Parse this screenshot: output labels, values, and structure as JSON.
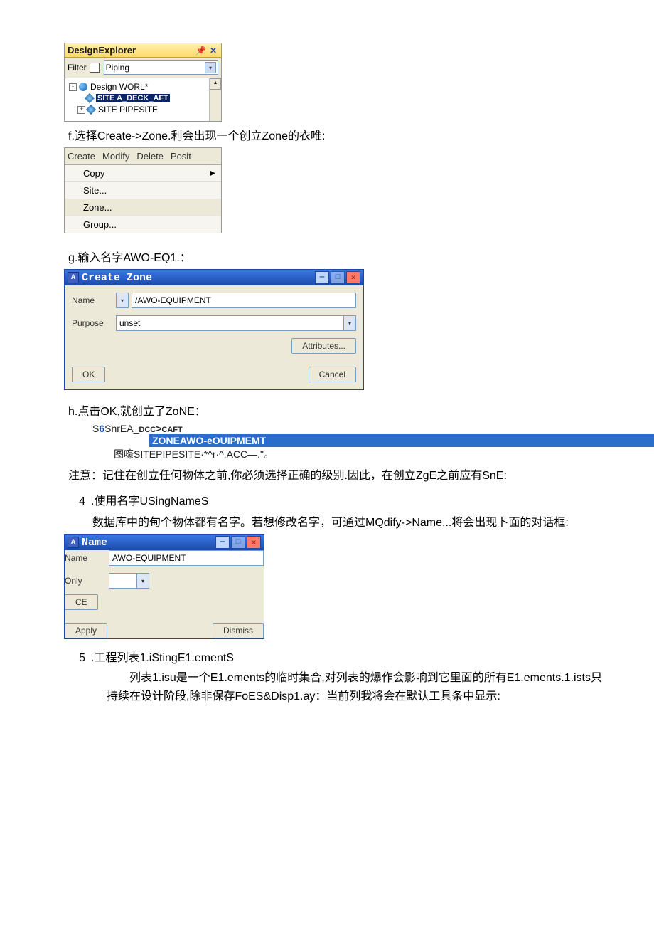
{
  "designExplorer": {
    "title": "DesignExplorer",
    "filterLabel": "Filter",
    "piping": "Piping",
    "rootNode": "Design WORL*",
    "selectedNode": "SITE A_DECK_AFT",
    "childNode": "SITE PIPESITE"
  },
  "stepF": "f.选择Create->Zone.利会出现一个创立Zone的衣唯:",
  "menu": {
    "create": "Create",
    "modify": "Modify",
    "delete": "Delete",
    "posit": "Posit",
    "copy": "Copy",
    "site": "Site...",
    "zone": "Zone...",
    "group": "Group..."
  },
  "stepG": "g.输入名字AWO-EQ1.：",
  "createZone": {
    "title": "Create Zone",
    "nameLabel": "Name",
    "nameValue": "/AWO-EQUIPMENT",
    "purposeLabel": "Purpose",
    "purposeValue": "unset",
    "attributesBtn": "Attributes...",
    "okBtn": "OK",
    "cancelBtn": "Cancel"
  },
  "stepH": "h.点击OK,就创立了ZoNE：",
  "hierarchy": {
    "line1": "S6SnrEA_DCC>CAFT",
    "zoneLine": "ZONEAWO-eOUIPMEMT",
    "line2": "图嚎SITEPIPESITE·*^r·^.ACC—.\"。"
  },
  "note": "注意：记住在创立任何物体之前,你必须选择正确的级别.因此，在创立ZgE之前应有SnE:",
  "item4": {
    "num": "4",
    "title": ".使用名字USingNameS",
    "body": "数据库中的甸个物体都有名字。若想修改名字，可通过MQdify->Name...将会出现卜面的对话框:"
  },
  "nameDialog": {
    "title": "Name",
    "nameLabel": "Name",
    "nameValue": "AWO-EQUIPMENT",
    "onlyLabel": "Only",
    "ceBtn": "CE",
    "applyBtn": "Apply",
    "dismissBtn": "Dismiss"
  },
  "item5": {
    "num": "5",
    "title": ".工程列表1.iStingE1.ementS",
    "body": "列表1.isu是一个E1.ements的临时集合,对列表的爆作会影响到它里面的所有E1.ements.1.ists只持续在设计阶段,除非保存FoES&Disp1.ay：当前列我将会在默认工具条中显示:"
  }
}
